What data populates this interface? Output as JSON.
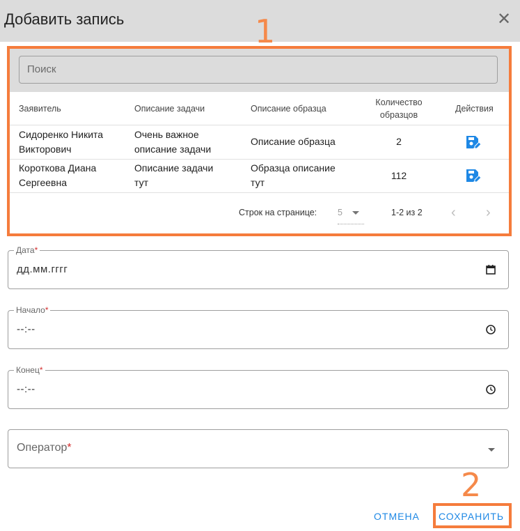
{
  "dialog": {
    "title": "Добавить запись",
    "close_icon": "close-icon"
  },
  "annotations": {
    "label1": "1",
    "label2": "2",
    "highlight_color": "#f57c3c"
  },
  "search": {
    "placeholder": "Поиск"
  },
  "table": {
    "headers": {
      "applicant": "Заявитель",
      "task": "Описание задачи",
      "sample": "Описание образца",
      "count_line1": "Количество",
      "count_line2": "образцов",
      "actions": "Действия"
    },
    "rows": [
      {
        "applicant_line1": "Сидоренко Никита",
        "applicant_line2": "Викторович",
        "task_line1": "Очень важное",
        "task_line2": "описание задачи",
        "sample_line1": "Описание образца",
        "sample_line2": "",
        "count": "2",
        "action_icon": "save-edit-icon"
      },
      {
        "applicant_line1": "Короткова Диана",
        "applicant_line2": "Сергеевна",
        "task_line1": "Описание задачи",
        "task_line2": "тут",
        "sample_line1": "Образца описание",
        "sample_line2": "тут",
        "count": "112",
        "action_icon": "save-edit-icon"
      }
    ],
    "pagination": {
      "rows_per_page_label": "Строк на странице:",
      "rows_per_page_value": "5",
      "range": "1-2 из 2"
    }
  },
  "form": {
    "date": {
      "label": "Дата",
      "required_mark": "*",
      "value": "дд.мм.гггг",
      "icon": "calendar-icon"
    },
    "start": {
      "label": "Начало",
      "required_mark": "*",
      "value": "--:--",
      "icon": "clock-icon"
    },
    "end": {
      "label": "Конец",
      "required_mark": "*",
      "value": "--:--",
      "icon": "clock-icon"
    },
    "operator": {
      "label": "Оператор",
      "required_mark": "*",
      "icon": "chevron-down-icon"
    }
  },
  "actions": {
    "cancel": "ОТМЕНА",
    "save": "СОХРАНИТЬ"
  },
  "colors": {
    "accent": "#1e88e5",
    "header_bg": "#dcdcdc",
    "required": "#d32f2f"
  }
}
